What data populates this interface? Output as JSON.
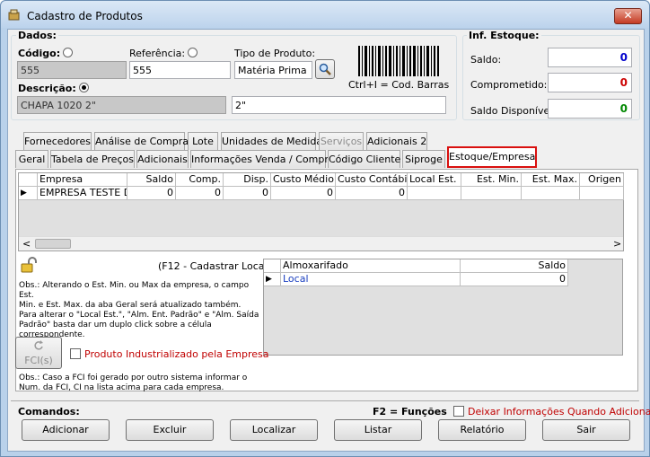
{
  "window": {
    "title": "Cadastro de Produtos",
    "close_glyph": "✕"
  },
  "dados": {
    "group_title": "Dados:",
    "codigo_label": "Código:",
    "codigo_value": "555",
    "referencia_label": "Referência:",
    "referencia_value": "555",
    "tipo_label": "Tipo de Produto:",
    "tipo_value": "Matéria Prima",
    "barcode_hint": "Ctrl+I = Cod. Barras",
    "descricao_label": "Descrição:",
    "descricao_value": "CHAPA 1020 2\"",
    "descricao_extra": "2\""
  },
  "estoque": {
    "group_title": "Inf. Estoque:",
    "saldo_label": "Saldo:",
    "saldo_value": "0",
    "saldo_color": "#0000cc",
    "comprometido_label": "Comprometido:",
    "comprometido_value": "0",
    "comprometido_color": "#cc0000",
    "disponivel_label": "Saldo Disponível:",
    "disponivel_value": "0",
    "disponivel_color": "#008800"
  },
  "tabs_row1": [
    "Fornecedores",
    "Análise de Compra",
    "Lote",
    "Unidades de Medida",
    "Serviços",
    "Adicionais 2"
  ],
  "tabs_row2": [
    "Geral",
    "Tabela de Preços",
    "Adicionais",
    "Informações Venda / Compra",
    "Código Cliente",
    "Siproge",
    "Estoque/Empresa"
  ],
  "grid": {
    "headers": [
      "Empresa",
      "Saldo",
      "Comp.",
      "Disp.",
      "Custo Médio",
      "Custo Contábil",
      "Local Est.",
      "Est. Min.",
      "Est. Max.",
      "Origen"
    ],
    "row": [
      "EMPRESA TESTE DE",
      "0",
      "0",
      "0",
      "0",
      "0",
      "",
      "",
      "",
      ""
    ],
    "row_marker": "▶",
    "scroll_left": "<",
    "scroll_right": ">"
  },
  "f12_hint": "(F12 - Cadastrar Local)",
  "lock_icon": "lock-icon",
  "obs1_lines": [
    "Obs.: Alterando o Est. Min. ou Max da empresa, o campo Est.",
    "Min. e Est. Max. da aba Geral será atualizado também.",
    "Para alterar o \"Local Est.\", \"Alm. Ent. Padrão\" e \"Alm. Saída",
    "Padrão\" basta dar um duplo click sobre a célula correspondente."
  ],
  "almox": {
    "headers": [
      "Almoxarifado",
      "Saldo"
    ],
    "row": [
      "Local",
      "0"
    ],
    "row_marker": "▶"
  },
  "fci_button": "FCI(s)",
  "industrializado_label": "Produto Industrializado pela Empresa",
  "obs2_lines": [
    "Obs.: Caso a FCI foi gerado por outro sistema informar o",
    "Num. da FCI, CI na lista acima para cada empresa."
  ],
  "comandos": {
    "title": "Comandos:",
    "f2_hint": "F2 = Funções",
    "deixar_label": "Deixar Informações Quando Adicionar",
    "buttons": [
      "Adicionar",
      "Excluir",
      "Localizar",
      "Listar",
      "Relatório",
      "Sair"
    ]
  }
}
